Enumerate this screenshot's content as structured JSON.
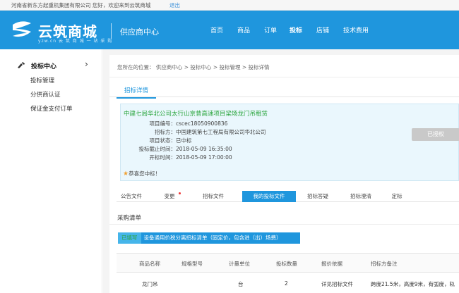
{
  "topbar": {
    "greeting": "河南省新东方起重机集团有限公司 您好，欢迎来到云筑商城",
    "logout": "退出"
  },
  "header": {
    "logo_text": "云筑商城",
    "logo_sub": "yzw.cn  云 筑 商 城  一 站 采 购",
    "title": "供应商中心",
    "nav": [
      "首页",
      "商品",
      "订单",
      "投标",
      "店铺",
      "技术费用"
    ],
    "brand_color": "#1f96dd"
  },
  "sidebar": {
    "header": "投标中心",
    "items": [
      "投标管理",
      "分供商认证",
      "保证金支付订单"
    ]
  },
  "breadcrumb": "您所在的位置：  供应商中心 > 投标中心 > 投标管理 > 投标详情",
  "detail_tab": "招标详情",
  "info": {
    "title": "中建七局华北公司太行山京昔高速项目梁场龙门吊租赁",
    "rows": [
      {
        "key": "项目编号：",
        "value": "cscec18050900836"
      },
      {
        "key": "招标方：",
        "value": "中国建筑第七工程局有限公司华北公司"
      },
      {
        "key": "项目状态：",
        "value": "已中标"
      },
      {
        "key": "投标截止时间：",
        "value": "2018-05-09 16:35:00"
      },
      {
        "key": "开标时间：",
        "value": "2018-05-09 17:00:00"
      }
    ],
    "congrats": "恭喜您中标！",
    "status_button": "已授权"
  },
  "subtabs": [
    "公告文件",
    "变更",
    "招标文件",
    "我的投标文件",
    "招标答疑",
    "招标澄清",
    "定标"
  ],
  "active_subtab": "我的投标文件",
  "section_label": "采购清单",
  "list_bar": {
    "tag": "已填写",
    "text": "设备通用价税分离招标清单（固定价，包含进（出）场费）"
  },
  "table": {
    "headers": [
      "商品名称",
      "规格型号",
      "计量单位",
      "投标数量",
      "报价依据",
      "招标方备注"
    ],
    "rows": [
      [
        "龙门吊",
        "",
        "台",
        "2",
        "详见招标文件",
        "跨度21.5米，高度9米，有弧度，轨"
      ]
    ]
  }
}
